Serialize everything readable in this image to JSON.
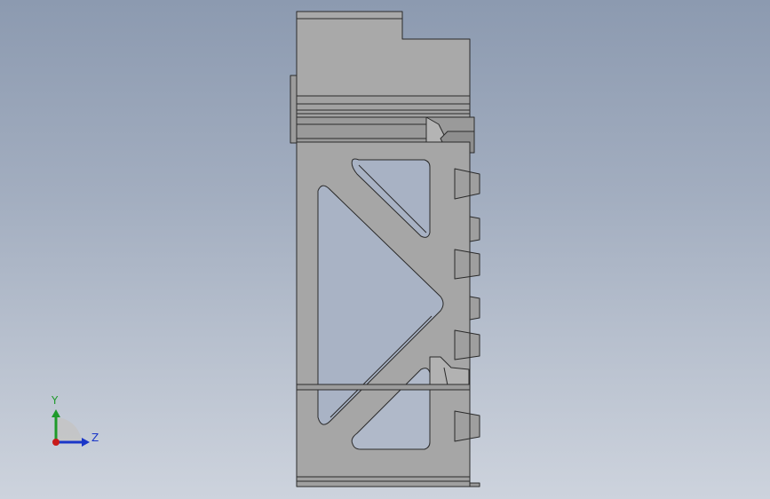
{
  "viewport": {
    "background_top": "#8c9ab0",
    "background_bottom": "#cdd3dd",
    "part_fill": "#a8a8a8",
    "part_stroke": "#2a2a2a"
  },
  "triad": {
    "y_label": "Y",
    "z_label": "Z",
    "y_color": "#1e9a2a",
    "z_color": "#1a36c8",
    "x_color": "#c81a1a"
  }
}
